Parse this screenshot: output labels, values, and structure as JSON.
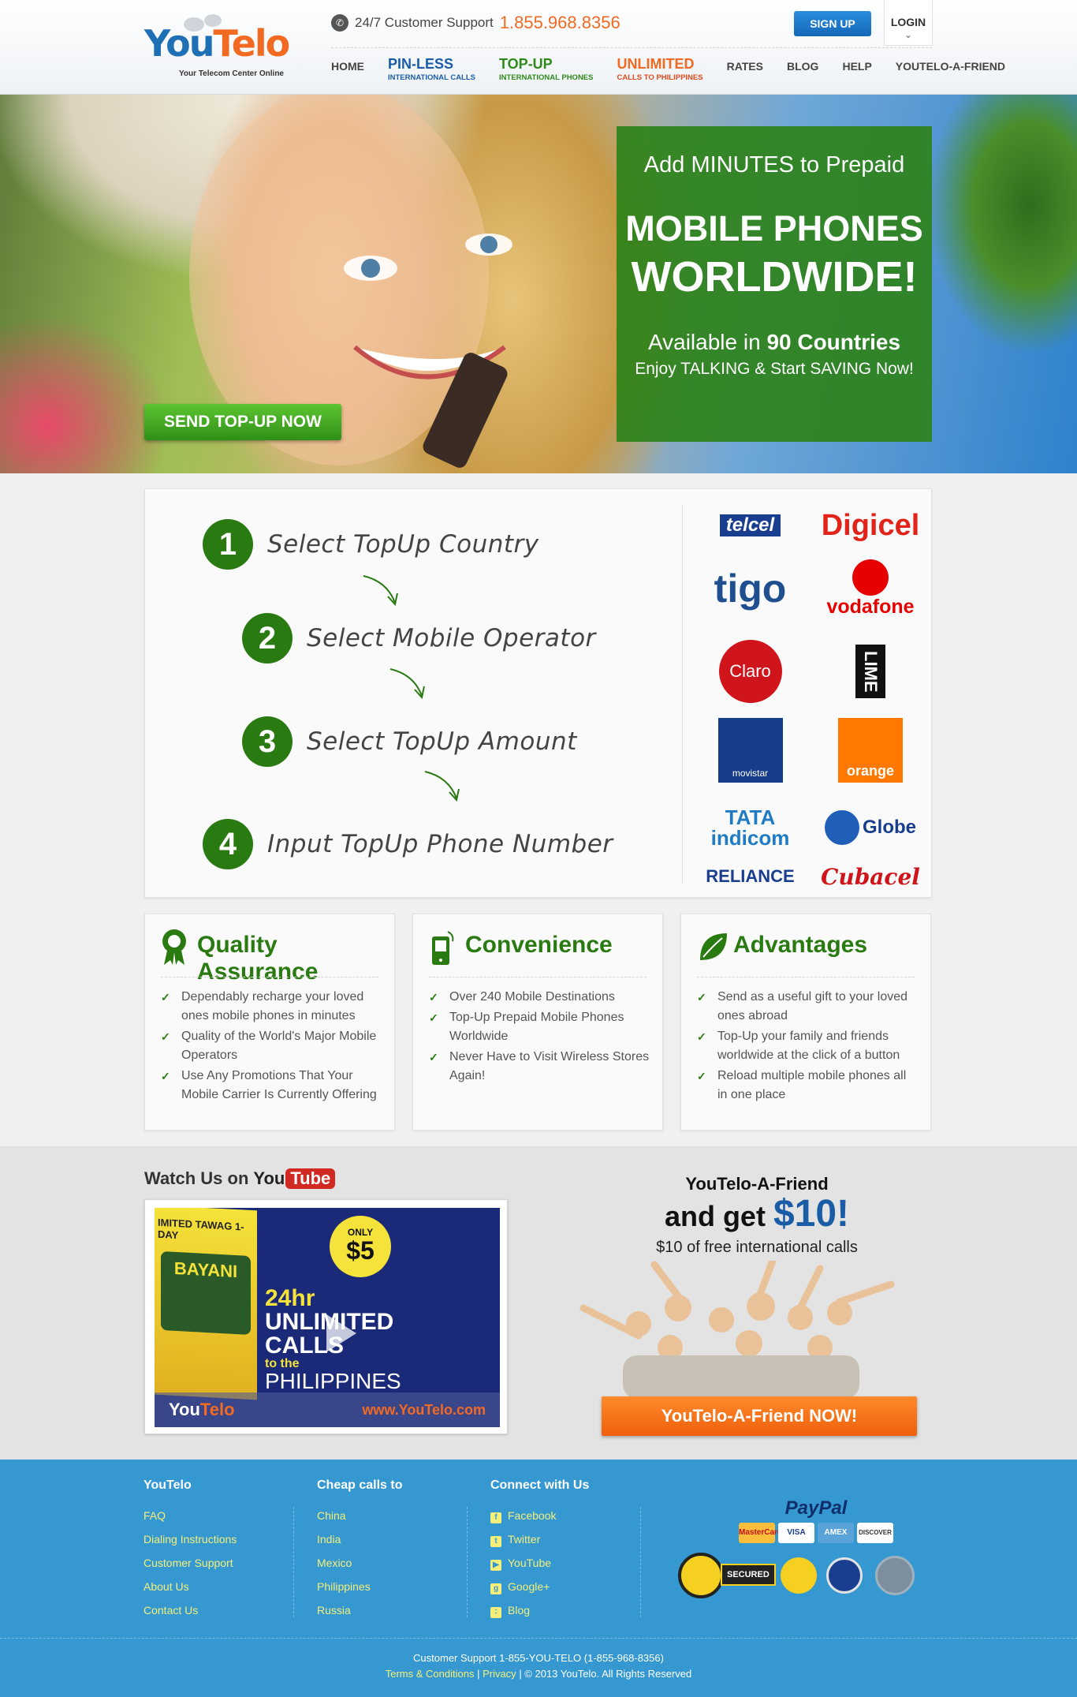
{
  "brand": {
    "logo_you": "You",
    "logo_telo": "Telo",
    "tagline": "Your Telecom Center Online"
  },
  "header": {
    "support_label": "24/7 Customer Support",
    "support_number": "1.855.968.8356",
    "signup": "SIGN UP",
    "login": "LOGIN"
  },
  "nav": [
    {
      "label": "HOME"
    },
    {
      "label": "PIN-LESS",
      "sub": "INTERNATIONAL CALLS"
    },
    {
      "label": "TOP-UP",
      "sub": "INTERNATIONAL PHONES"
    },
    {
      "label": "UNLIMITED",
      "sub": "CALLS TO PHILIPPINES"
    },
    {
      "label": "RATES"
    },
    {
      "label": "BLOG"
    },
    {
      "label": "HELP"
    },
    {
      "label": "YOUTELO-A-FRIEND"
    }
  ],
  "hero": {
    "cta": "SEND TOP-UP NOW",
    "line1": "Add MINUTES to Prepaid",
    "line2": "MOBILE PHONES",
    "line3": "WORLDWIDE!",
    "line4_pre": "Available in",
    "line4_bold": "90 Countries",
    "line5": "Enjoy TALKING & Start SAVING Now!"
  },
  "steps": [
    {
      "num": "1",
      "text": "Select TopUp Country"
    },
    {
      "num": "2",
      "text": "Select Mobile Operator"
    },
    {
      "num": "3",
      "text": "Select TopUp Amount"
    },
    {
      "num": "4",
      "text": "Input TopUp Phone Number"
    }
  ],
  "operators": [
    "telcel",
    "Digicel",
    "tigo",
    "vodafone",
    "Claro",
    "LIME",
    "movistar",
    "orange",
    "TATA indicom",
    "Globe",
    "RELIANCE",
    "Cubacel"
  ],
  "features": [
    {
      "title": "Quality Assurance",
      "icon": "award-ribbon-icon",
      "items": [
        "Dependably recharge your loved ones mobile phones in minutes",
        "Quality of the World's Major Mobile Operators",
        "Use Any Promotions That Your Mobile Carrier Is Currently Offering"
      ]
    },
    {
      "title": "Convenience",
      "icon": "mobile-phone-icon",
      "items": [
        "Over 240 Mobile Destinations",
        "Top-Up Prepaid Mobile Phones Worldwide",
        "Never Have to Visit Wireless Stores Again!"
      ]
    },
    {
      "title": "Advantages",
      "icon": "leaf-icon",
      "items": [
        "Send as a useful gift to your loved ones abroad",
        "Top-Up your family and friends worldwide at the click of a button",
        "Reload multiple mobile phones all in one place"
      ]
    }
  ],
  "video": {
    "heading": "Watch Us on",
    "yt_you": "You",
    "yt_tube": "Tube",
    "card_text": "IMITED TAWAG 1-DAY",
    "brand_word": "BAYANI",
    "only": "ONLY",
    "price": "$5",
    "h1": "24hr",
    "h2": "UNLIMITED",
    "h3": "CALLS",
    "h4": "to the",
    "h5": "PHILIPPINES",
    "url": "www.YouTelo.com"
  },
  "referral": {
    "title": "YouTelo-A-Friend",
    "get_pre": "and get",
    "get_amount": "$10!",
    "sub": "$10 of free international calls",
    "button": "YouTelo-A-Friend NOW!"
  },
  "footer": {
    "col1": {
      "title": "YouTelo",
      "links": [
        "FAQ",
        "Dialing Instructions",
        "Customer Support",
        "About Us",
        "Contact Us"
      ]
    },
    "col2": {
      "title": "Cheap calls to",
      "links": [
        "China",
        "India",
        "Mexico",
        "Philippines",
        "Russia"
      ]
    },
    "col3": {
      "title": "Connect with Us",
      "links": [
        "Facebook",
        "Twitter",
        "YouTube",
        "Google+",
        "Blog"
      ]
    },
    "paypal": "PayPal",
    "cards": [
      "MasterCard",
      "VISA",
      "AMEX",
      "DISCOVER"
    ],
    "secured": "SECURED",
    "support_line": "Customer Support 1-855-YOU-TELO (1-855-968-8356)",
    "terms": "Terms & Conditions",
    "privacy": "Privacy",
    "copyright": "| © 2013 YouTelo. All Rights Reserved"
  },
  "colors": {
    "green": "#2a7a12",
    "blue": "#1a5da6",
    "orange": "#f26a21",
    "footer": "#3598d0"
  }
}
